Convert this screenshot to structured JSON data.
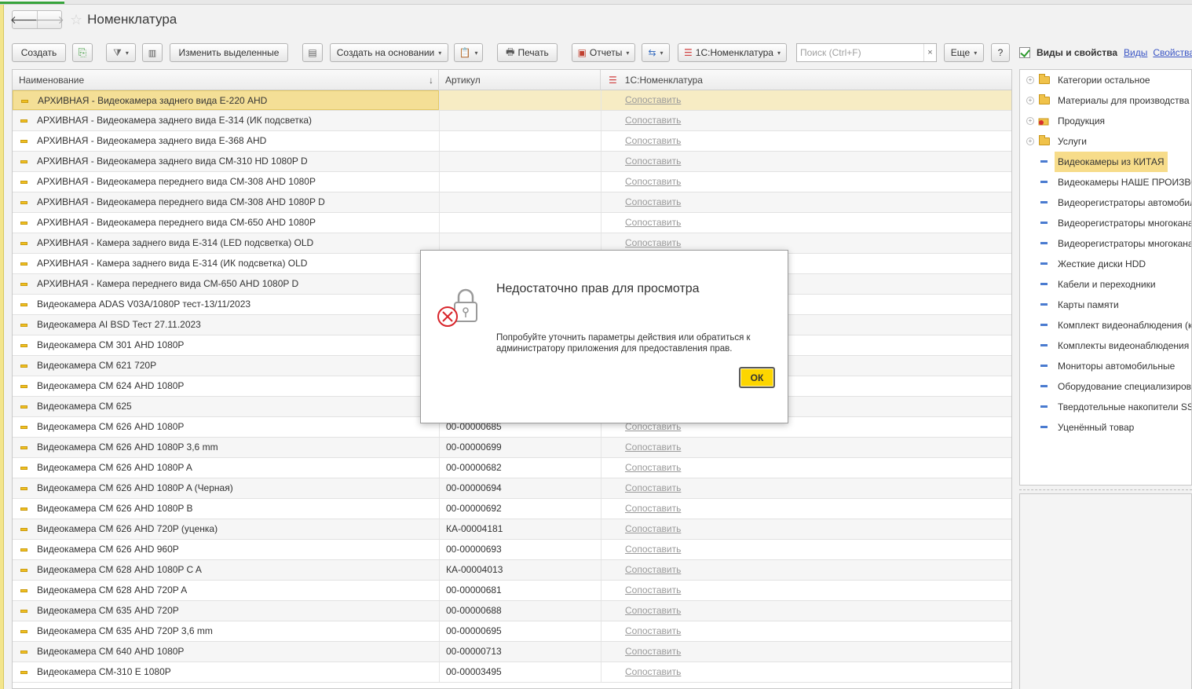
{
  "window": {
    "title": "Номенклатура",
    "back_icon": "arrow-left-icon",
    "forward_icon": "arrow-right-icon",
    "favorite_icon": "star-icon"
  },
  "toolbar": {
    "create_label": "Создать",
    "edit_selected_label": "Изменить выделенные",
    "create_based_on_label": "Создать на основании",
    "print_label": "Печать",
    "reports_label": "Отчеты",
    "nomenclature_1c_label": "1С:Номенклатура",
    "search_placeholder": "Поиск (Ctrl+F)",
    "search_clear": "×",
    "more_label": "Еще",
    "help_label": "?"
  },
  "grid": {
    "columns": [
      "Наименование",
      "Артикул",
      "1С:Номенклатура"
    ],
    "sort_indicator": "↓",
    "link_text": "Сопоставить",
    "rows": [
      {
        "name": "АРХИВНАЯ - Видеокамера заднего вида Е-220 AHD",
        "article": "",
        "map": "Сопоставить"
      },
      {
        "name": "АРХИВНАЯ - Видеокамера заднего вида Е-314 (ИК подсветка)",
        "article": "",
        "map": "Сопоставить"
      },
      {
        "name": "АРХИВНАЯ - Видеокамера заднего вида Е-368 AHD",
        "article": "",
        "map": "Сопоставить"
      },
      {
        "name": "АРХИВНАЯ - Видеокамера заднего вида СМ-310 HD 1080P D",
        "article": "",
        "map": "Сопоставить"
      },
      {
        "name": "АРХИВНАЯ - Видеокамера переднего вида СМ-308 AHD 1080P",
        "article": "",
        "map": "Сопоставить"
      },
      {
        "name": "АРХИВНАЯ - Видеокамера переднего вида СМ-308 AHD 1080P D",
        "article": "",
        "map": "Сопоставить"
      },
      {
        "name": "АРХИВНАЯ - Видеокамера переднего вида СМ-650 AHD 1080P",
        "article": "",
        "map": "Сопоставить"
      },
      {
        "name": "АРХИВНАЯ - Камера заднего вида Е-314 (LED подсветка) OLD",
        "article": "",
        "map": "Сопоставить"
      },
      {
        "name": "АРХИВНАЯ - Камера заднего вида Е-314 (ИК подсветка) OLD",
        "article": "",
        "map": ""
      },
      {
        "name": "АРХИВНАЯ - Камера переднего вида СМ-650 AHD 1080P D",
        "article": "",
        "map": ""
      },
      {
        "name": "Видеокамера ADAS V03A/1080P тест-13/11/2023",
        "article": "",
        "map": ""
      },
      {
        "name": "Видеокамера AI BSD Тест 27.11.2023",
        "article": "",
        "map": ""
      },
      {
        "name": "Видеокамера СМ 301 AHD 1080P",
        "article": "",
        "map": ""
      },
      {
        "name": "Видеокамера СМ 621 720P",
        "article": "",
        "map": ""
      },
      {
        "name": "Видеокамера СМ 624 AHD 1080P",
        "article": "",
        "map": ""
      },
      {
        "name": "Видеокамера СМ 625",
        "article": "",
        "map": ""
      },
      {
        "name": "Видеокамера СМ 626 AHD 1080P",
        "article": "00-00000685",
        "map": "Сопоставить"
      },
      {
        "name": "Видеокамера СМ 626 AHD 1080P 3,6 mm",
        "article": "00-00000699",
        "map": "Сопоставить"
      },
      {
        "name": "Видеокамера СМ 626 AHD 1080P A",
        "article": "00-00000682",
        "map": "Сопоставить"
      },
      {
        "name": "Видеокамера СМ 626 AHD 1080P A (Черная)",
        "article": "00-00000694",
        "map": "Сопоставить"
      },
      {
        "name": "Видеокамера СМ 626 AHD 1080P B",
        "article": "00-00000692",
        "map": "Сопоставить"
      },
      {
        "name": "Видеокамера СМ 626 AHD 720P (уценка)",
        "article": "КА-00004181",
        "map": "Сопоставить"
      },
      {
        "name": "Видеокамера СМ 626 AHD 960P",
        "article": "00-00000693",
        "map": "Сопоставить"
      },
      {
        "name": "Видеокамера СМ 628 AHD 1080P C A",
        "article": "КА-00004013",
        "map": "Сопоставить"
      },
      {
        "name": "Видеокамера СМ 628 AHD 720P A",
        "article": "00-00000681",
        "map": "Сопоставить"
      },
      {
        "name": "Видеокамера СМ 635 AHD 720P",
        "article": "00-00000688",
        "map": "Сопоставить"
      },
      {
        "name": "Видеокамера СМ 635 AHD 720P 3,6 mm",
        "article": "00-00000695",
        "map": "Сопоставить"
      },
      {
        "name": "Видеокамера СМ 640 AHD 1080P",
        "article": "00-00000713",
        "map": "Сопоставить"
      },
      {
        "name": "Видеокамера СМ-310 Е 1080P",
        "article": "00-00003495",
        "map": "Сопоставить"
      }
    ]
  },
  "right_panel": {
    "checkbox_label": "Виды и свойства",
    "link1": "Виды",
    "link2": "Свойства",
    "items": [
      {
        "label": "Категории остальное",
        "kind": "folder"
      },
      {
        "label": "Материалы для производства",
        "kind": "folder"
      },
      {
        "label": "Продукция",
        "kind": "product"
      },
      {
        "label": "Услуги",
        "kind": "folder"
      },
      {
        "label": "Видеокамеры из КИТАЯ",
        "kind": "item"
      },
      {
        "label": "Видеокамеры НАШЕ ПРОИЗВОДСТВО",
        "kind": "item"
      },
      {
        "label": "Видеорегистраторы автомобильные",
        "kind": "item"
      },
      {
        "label": "Видеорегистраторы многоканальные",
        "kind": "item"
      },
      {
        "label": "Видеорегистраторы многоканальные",
        "kind": "item"
      },
      {
        "label": "Жесткие диски HDD",
        "kind": "item"
      },
      {
        "label": "Кабели и переходники",
        "kind": "item"
      },
      {
        "label": "Карты памяти",
        "kind": "item"
      },
      {
        "label": "Комплект видеонаблюдения (к",
        "kind": "item"
      },
      {
        "label": "Комплекты видеонаблюдения",
        "kind": "item"
      },
      {
        "label": "Мониторы автомобильные",
        "kind": "item"
      },
      {
        "label": "Оборудование специализированное",
        "kind": "item"
      },
      {
        "label": "Твердотельные накопители SSD",
        "kind": "item"
      },
      {
        "label": "Уценённый товар",
        "kind": "item"
      }
    ]
  },
  "dialog": {
    "title": "Недостаточно прав для просмотра",
    "message": "Попробуйте уточнить параметры действия или обратиться к администратору приложения для предоставления прав.",
    "ok_label": "ОК",
    "icon": "lock-error-icon"
  },
  "colors": {
    "selection": "#f7ecc4",
    "ok_button": "#fdd600",
    "link": "#3a55c5",
    "checkbox_mark": "#2e9a2e"
  }
}
